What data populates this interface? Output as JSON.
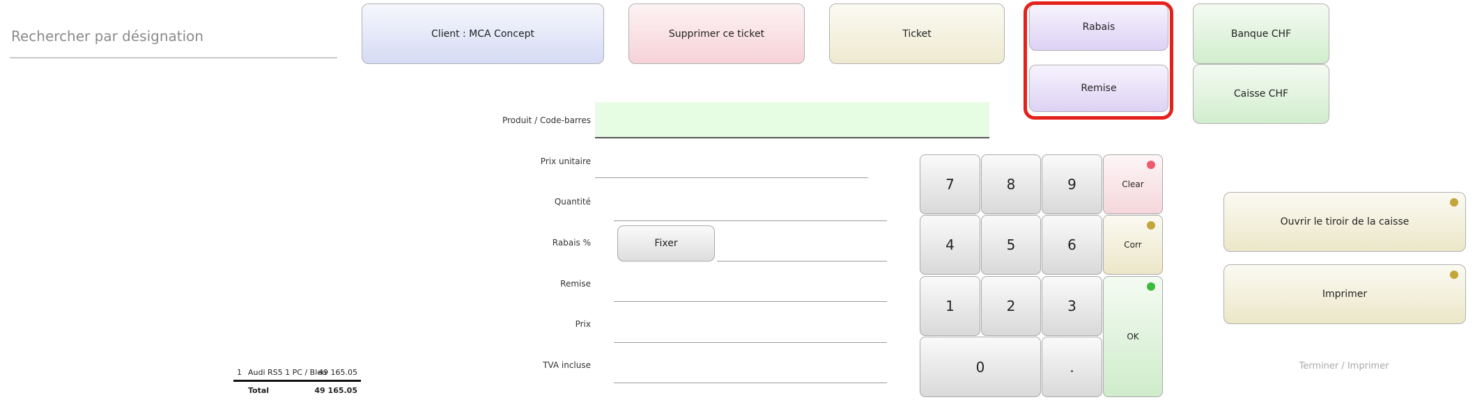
{
  "search": {
    "placeholder": "Rechercher par désignation"
  },
  "actions": {
    "client": "Client : MCA Concept",
    "delete_ticket": "Supprimer ce ticket",
    "ticket": "Ticket",
    "rabais": "Rabais",
    "remise": "Remise",
    "banque": "Banque CHF",
    "caisse": "Caisse CHF"
  },
  "form": {
    "produit": "Produit / Code-barres",
    "prix_unitaire": "Prix unitaire",
    "quantite": "Quantité",
    "rabais_pct": "Rabais %",
    "fixer": "Fixer",
    "remise": "Remise",
    "prix": "Prix",
    "tva": "TVA incluse"
  },
  "keypad": {
    "k7": "7",
    "k8": "8",
    "k9": "9",
    "k4": "4",
    "k5": "5",
    "k6": "6",
    "k1": "1",
    "k2": "2",
    "k3": "3",
    "k0": "0",
    "kdot": ".",
    "clear": "Clear",
    "corr": "Corr",
    "ok": "OK"
  },
  "right_panel": {
    "ouvrir": "Ouvrir le tiroir de la caisse",
    "imprimer": "Imprimer",
    "terminer": "Terminer / Imprimer"
  },
  "ticket": {
    "items": [
      {
        "qty": "1",
        "name": "Audi RS5 1 PC / Bleu",
        "amount": "49 165.05"
      }
    ],
    "total_label": "Total",
    "total_value": "49 165.05"
  },
  "colors": {
    "highlight": "#e5201a",
    "dot_red": "#f0586e",
    "dot_gold": "#c3a53a",
    "dot_green": "#3dbb3a"
  }
}
